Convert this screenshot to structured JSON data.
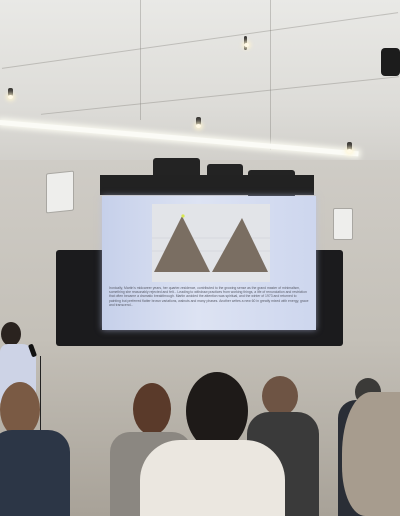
{
  "scene": {
    "description_tag": "lecture",
    "screen": {
      "slide_text": "Ironically, Martin's midcareer years, her quarter-residence, contributed to the growing sense as the grand master of minimalism, something she reasonably rejected and felt... Leading to withdraw practices from working things, a life of renunciation and restriction that often became a dramatic breakthrough. Martin avoided the attention was spiritual, and the winter of 1973 and returned to painting but preferred flatter brown variations, walnuts and many phases. Another writes a new 60 in greatly mixed with energy, grace and transcend..."
    },
    "colors": {
      "screen_glow": "#d8dff2",
      "mountain": "#7a6e62",
      "wall": "#c8c4bd",
      "bezel": "#1b1b1d"
    }
  }
}
